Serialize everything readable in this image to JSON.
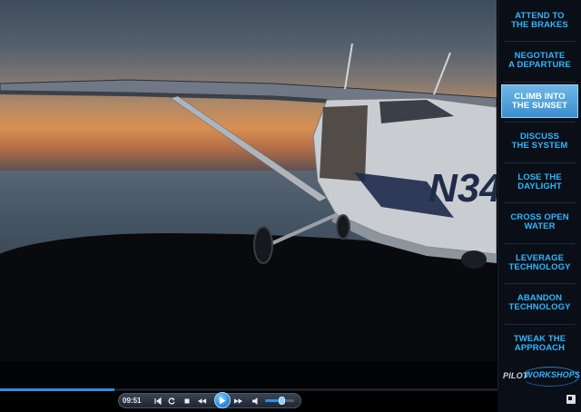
{
  "menu": {
    "items": [
      {
        "label": "ATTEND TO\nTHE BRAKES",
        "active": false
      },
      {
        "label": "NEGOTIATE\nA DEPARTURE",
        "active": false
      },
      {
        "label": "CLIMB INTO\nTHE SUNSET",
        "active": true
      },
      {
        "label": "DISCUSS\nTHE SYSTEM",
        "active": false
      },
      {
        "label": "LOSE THE\nDAYLIGHT",
        "active": false
      },
      {
        "label": "CROSS OPEN\nWATER",
        "active": false
      },
      {
        "label": "LEVERAGE\nTECHNOLOGY",
        "active": false
      },
      {
        "label": "ABANDON\nTECHNOLOGY",
        "active": false
      },
      {
        "label": "TWEAK THE\nAPPROACH",
        "active": false
      }
    ]
  },
  "brand": {
    "pilot": "PILOT",
    "workshops": "WORKSHOPS"
  },
  "video": {
    "tail_number": "N34"
  },
  "player": {
    "time": "09:51",
    "progress": 0.23,
    "volume": 0.55,
    "icons": {
      "rewind_start": "skip-back-icon",
      "replay": "replay-icon",
      "stop": "stop-icon",
      "rewind": "rewind-icon",
      "play": "play-icon",
      "forward": "fast-forward-icon",
      "volume": "volume-icon",
      "fullscreen": "fullscreen-icon"
    }
  },
  "colors": {
    "accent": "#2fb7ff",
    "active_bg": "#3a8fd0",
    "sidebar_bg": "#0a0f17"
  }
}
